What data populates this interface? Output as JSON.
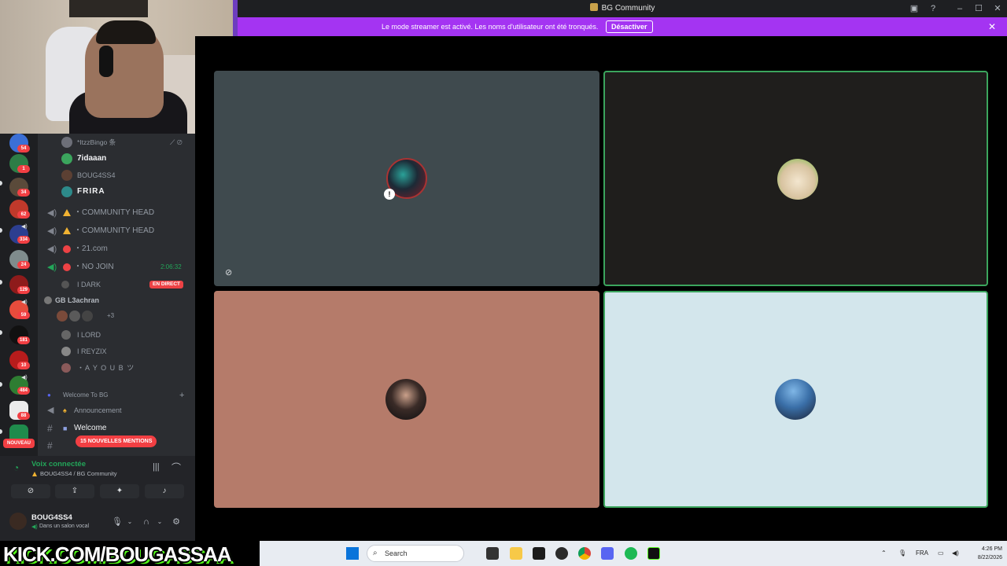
{
  "window": {
    "title": "BG Community",
    "controls": [
      "inbox-icon",
      "help-icon",
      "minimize-icon",
      "maximize-icon",
      "close-icon"
    ]
  },
  "banner": {
    "text": "Le mode streamer est activé. Les noms d'utilisateur ont été tronqués.",
    "button": "Désactiver",
    "close": "✕"
  },
  "servers": [
    {
      "badge": "54"
    },
    {
      "badge": "1"
    },
    {
      "badge": "34"
    },
    {
      "badge": "62"
    },
    {
      "badge": "334"
    },
    {
      "badge": "24"
    },
    {
      "badge": "129"
    },
    {
      "badge": "59"
    },
    {
      "badge": "181"
    },
    {
      "badge": "10"
    },
    {
      "badge": "484"
    },
    {
      "badge": "88"
    },
    {
      "badge": ""
    }
  ],
  "nouveau_label": "NOUVEAU",
  "channel_list": {
    "members_top": [
      {
        "name": "*ItzzBingo 条",
        "bold": false,
        "color": "#6d6f78"
      },
      {
        "name": "7idaaan",
        "bold": true,
        "color": "#3ba55d"
      },
      {
        "name": "BOUG4SS4",
        "bold": false,
        "color": "#5c4033"
      },
      {
        "name": "FRIRA",
        "bold": true,
        "color": "#2d8a8a"
      }
    ],
    "voice_channels": [
      {
        "name": "・COMMUNITY HEAD",
        "icon": "warning-icon"
      },
      {
        "name": "・COMMUNITY HEAD",
        "icon": "warning-icon"
      },
      {
        "name": "・21.com",
        "icon": "ban-icon"
      },
      {
        "name": "・NO JOIN",
        "icon": "ban-icon",
        "timer": "2:06:32"
      }
    ],
    "members_bottom": [
      {
        "name": "I DARK",
        "live": "EN DIRECT"
      },
      {
        "name": "GB L3achran",
        "bold": true
      },
      {
        "name": "+3"
      },
      {
        "name": "I LORD"
      },
      {
        "name": "I REYZIX"
      },
      {
        "name": "・A Y O U B ツ"
      }
    ],
    "category": "Welcome To BG",
    "text_channels": [
      {
        "name": "Announcement"
      },
      {
        "name": "Welcome"
      }
    ],
    "mentions_label": "15 NOUVELLES MENTIONS"
  },
  "voice_panel": {
    "title": "Voix connectée",
    "subtitle": "BOUG4SS4 / BG Community",
    "buttons": [
      "camera-off-icon",
      "screen-share-icon",
      "activities-icon",
      "soundboard-icon"
    ]
  },
  "user_panel": {
    "username": "BOUG4SS4",
    "status": "Dans un salon vocal"
  },
  "watermark": "KICK.COM/BOUGASSAA",
  "tiles": [
    {
      "bg": "#3f4a4e",
      "speaking": false
    },
    {
      "bg": "#1f1e1c",
      "speaking": true
    },
    {
      "bg": "#b57b6a",
      "speaking": false
    },
    {
      "bg": "#d3e6ec",
      "speaking": true
    }
  ],
  "taskbar": {
    "search_placeholder": "Search",
    "lang": "FRA",
    "time": "4:26 PM",
    "date": "8/22/2026"
  }
}
